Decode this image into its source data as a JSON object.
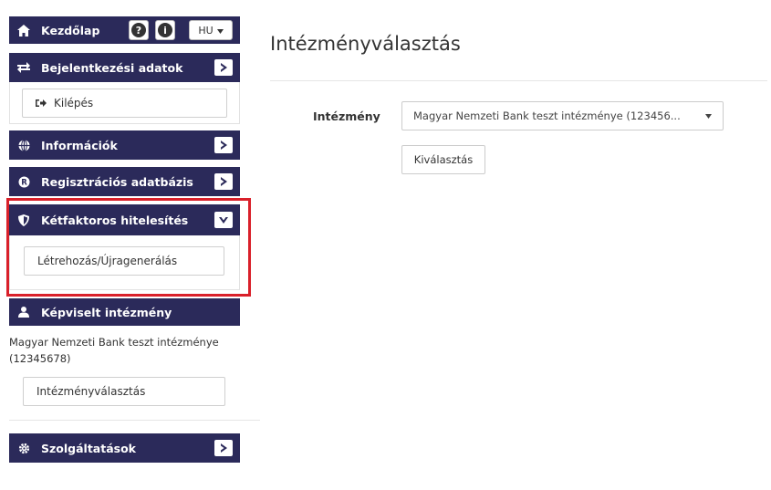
{
  "sidebar": {
    "home_label": "Kezdőlap",
    "lang_label": "HU",
    "login_data_label": "Bejelentkezési adatok",
    "logout_label": "Kilépés",
    "info_label": "Információk",
    "registry_label": "Regisztrációs adatbázis",
    "twofactor_label": "Kétfaktoros hitelesítés",
    "create_regen_label": "Létrehozás/Újragenerálás",
    "represented_label": "Képviselt intézmény",
    "represented_name": "Magyar Nemzeti Bank teszt intézménye (12345678)",
    "institution_select_label": "Intézményválasztás",
    "services_label": "Szolgáltatások"
  },
  "main": {
    "title": "Intézményválasztás",
    "field_label": "Intézmény",
    "select_value": "Magyar Nemzeti Bank teszt intézménye (123456...",
    "submit_label": "Kiválasztás"
  },
  "icons": [
    "home-icon",
    "help-icon",
    "info-icon",
    "chevron-down-icon",
    "swap-icon",
    "logout-icon",
    "globe-icon",
    "registered-icon",
    "shield-icon",
    "user-icon",
    "gear-icon",
    "chevron-right-icon"
  ],
  "colors": {
    "nav_bar": "#2b2a5a",
    "highlight": "#d9202a"
  }
}
